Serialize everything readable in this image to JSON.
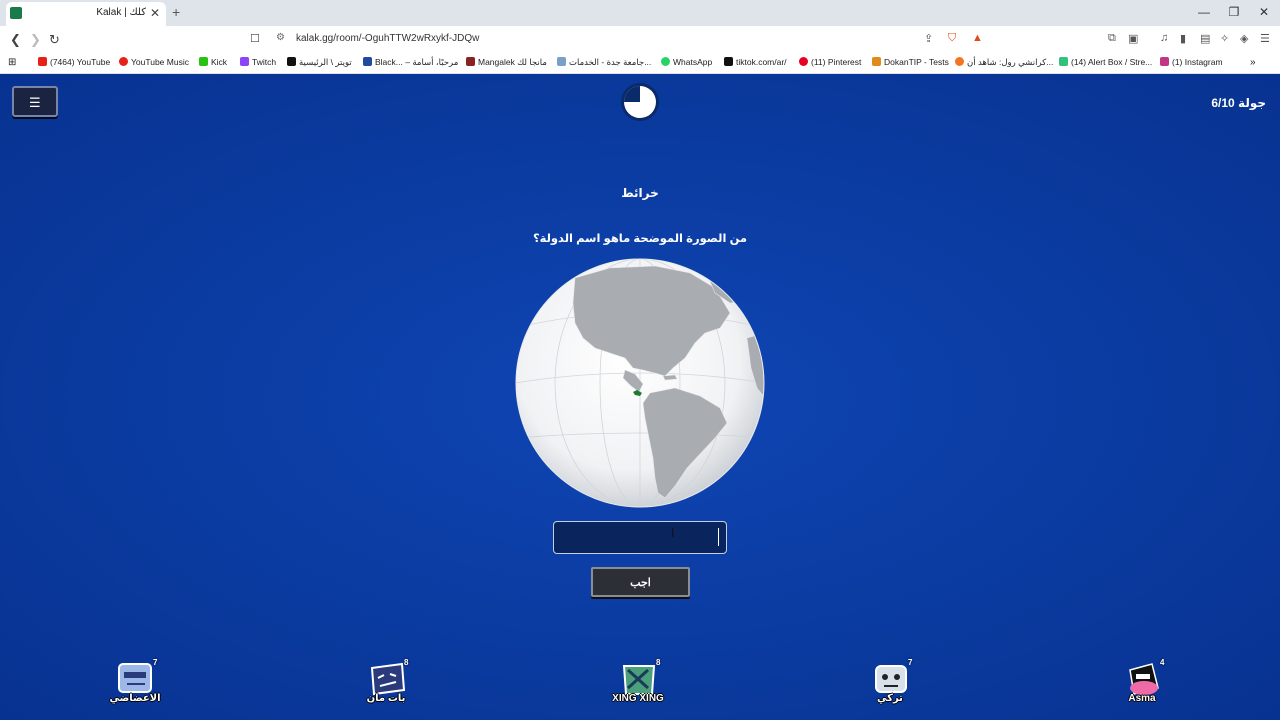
{
  "browser": {
    "tab_title": "Kalak | كلك",
    "tab_close": "✕",
    "new_tab": "+",
    "url": "kalak.gg/room/-OguhTTW2wRxykf-JDQw",
    "window_controls": [
      "—",
      "❐",
      "✕"
    ]
  },
  "bookmarks": [
    {
      "label": "(7464) YouTube",
      "color": "#e62117"
    },
    {
      "label": "YouTube Music",
      "color": "#e62117"
    },
    {
      "label": "Kick",
      "color": "#27c212"
    },
    {
      "label": "Twitch",
      "color": "#8b44f7"
    },
    {
      "label": "تويتر \\ الرئيسية",
      "color": "#111111"
    },
    {
      "label": "Black... – مرحبًا، أسامة",
      "color": "#1e4aa0"
    },
    {
      "label": "Mangalek مانجا لك",
      "color": "#8a2222"
    },
    {
      "label": "جامعة جدة - الخدمات...",
      "color": "#7aa0c8"
    },
    {
      "label": "WhatsApp",
      "color": "#25d366"
    },
    {
      "label": "tiktok.com/ar/",
      "color": "#111111"
    },
    {
      "label": "(11) Pinterest",
      "color": "#e60023"
    },
    {
      "label": "DokanTIP - Tests",
      "color": "#e08a1e"
    },
    {
      "label": "كرانشي رول: شاهد أن...",
      "color": "#f47521"
    },
    {
      "label": "(14) Alert Box / Stre...",
      "color": "#31c27c"
    },
    {
      "label": "(1) Instagram",
      "color": "#c13584"
    }
  ],
  "game": {
    "round_label": "جولة 6/10",
    "round": {
      "current": 6,
      "total": 10
    },
    "timer_remaining_fraction": 0.75,
    "category": "خرائط",
    "question": "من الصورة الموضحة ماهو اسم الدولة؟",
    "answer_value": "",
    "submit_label": "اجب",
    "highlight_color": "#1e7a2e"
  },
  "players": [
    {
      "name": "الاعضاضي",
      "score": "7",
      "avatar_color": "#9db8e8"
    },
    {
      "name": "بات مان",
      "score": "8",
      "avatar_color": "#2a3a7a"
    },
    {
      "name": "XING XING",
      "score": "8",
      "avatar_color": "#4aa07a"
    },
    {
      "name": "تركي",
      "score": "7",
      "avatar_color": "#d8e0ea"
    },
    {
      "name": "Asma",
      "score": "4",
      "avatar_color": "#f06aa8"
    }
  ]
}
